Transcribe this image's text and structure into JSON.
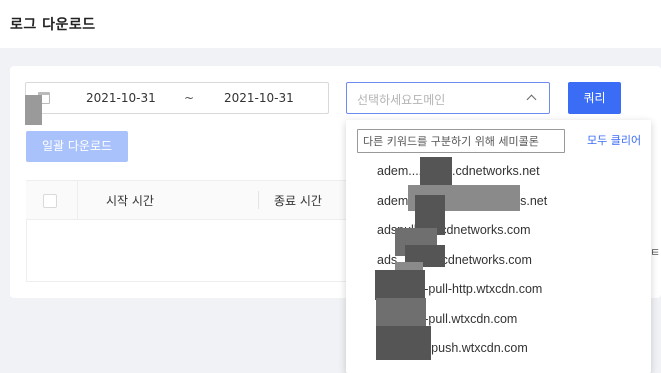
{
  "header": {
    "title": "로그 다운로드"
  },
  "filters": {
    "date_start": "2021-10-31",
    "date_separator": "~",
    "date_end": "2021-10-31",
    "domain_placeholder": "선택하세요도메인",
    "query_label": "쿼리"
  },
  "actions": {
    "bulk_download_label": "일괄 다운로드"
  },
  "table": {
    "columns": [
      "시작 시간",
      "종료 시간"
    ]
  },
  "dropdown": {
    "search_placeholder": "다른 키워드를 구분하기 위해 세미콜론",
    "clear_all_label": "모두 클리어",
    "items": [
      {
        "label": "adem.......pull.cdnetworks.net"
      },
      {
        "label": "adem.......push.cdnetworks.net"
      },
      {
        "label": "adspulltest.cdnetworks.com"
      },
      {
        "label": "ads.......est.cdnetworks.com"
      },
      {
        "label": "h.......ive-pull-http.wtxcdn.com"
      },
      {
        "label": "h.......ive-pull.wtxcdn.com"
      },
      {
        "label": "h.......live-push.wtxcdn.com"
      }
    ]
  },
  "colors": {
    "primary": "#3b6cf6",
    "primary_disabled": "#a9c2fb",
    "page_bg": "#f0f2f5"
  }
}
